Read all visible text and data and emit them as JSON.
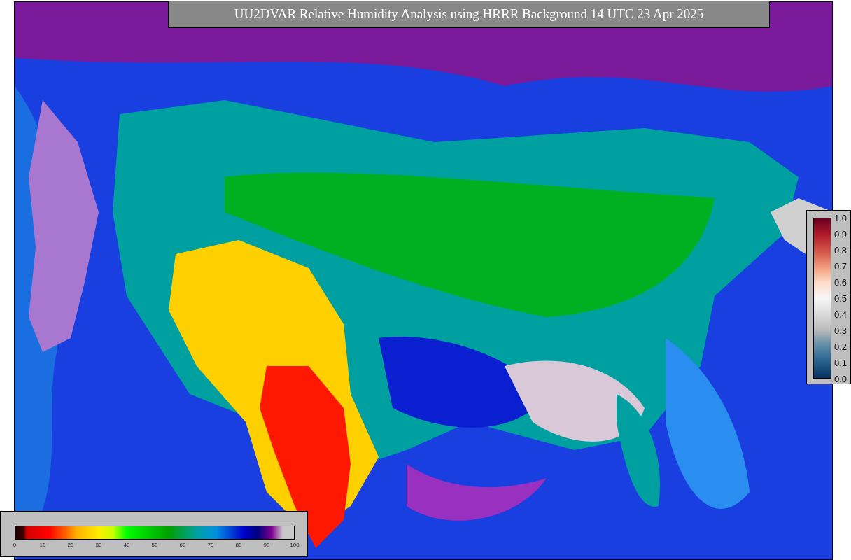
{
  "title": "UU2DVAR Relative Humidity Analysis using HRRR Background 14 UTC 23 Apr 2025",
  "humidity_legend": {
    "ticks": [
      "0",
      "10",
      "20",
      "30",
      "40",
      "50",
      "60",
      "70",
      "80",
      "90",
      "100"
    ]
  },
  "observation_legend": {
    "ticks": [
      "1.0",
      "0.9",
      "0.8",
      "0.7",
      "0.6",
      "0.5",
      "0.4",
      "0.3",
      "0.2",
      "0.1",
      "0.0"
    ]
  }
}
